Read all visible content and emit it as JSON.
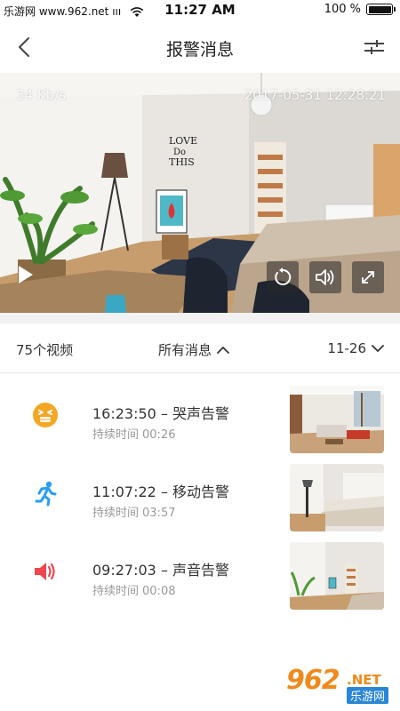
{
  "status_bar": {
    "carrier": "乐游网 www.962.net",
    "carrier_suffix": "ııı",
    "time": "11:27 AM",
    "battery": "100 %",
    "battery_level": 1.0
  },
  "nav": {
    "title": "报警消息",
    "back_icon": "chevron-left-icon",
    "filter_icon": "sliders-icon"
  },
  "video": {
    "bitrate": "34 Kb/s",
    "timestamp": "2017-05-31 12:28:21",
    "controls": [
      "play-icon",
      "replay-icon",
      "speaker-icon",
      "fullscreen-icon"
    ]
  },
  "filter_bar": {
    "count": "75个视频",
    "category": "所有消息",
    "date": "11-26"
  },
  "alarms": [
    {
      "title": "16:23:50 – 哭声告警",
      "duration_label": "持续时间",
      "duration": "00:26",
      "icon": "crying-face-icon",
      "color": "#f5a623"
    },
    {
      "title": "11:07:22 – 移动告警",
      "duration_label": "持续时间",
      "duration": "03:57",
      "icon": "running-person-icon",
      "color": "#2a9df4"
    },
    {
      "title": "09:27:03 – 声音告警",
      "duration_label": "持续时间",
      "duration": "00:08",
      "icon": "speaker-icon",
      "color": "#f0474f"
    }
  ],
  "watermark": {
    "number": "962",
    "net": ".NET",
    "cn": "乐游网"
  }
}
